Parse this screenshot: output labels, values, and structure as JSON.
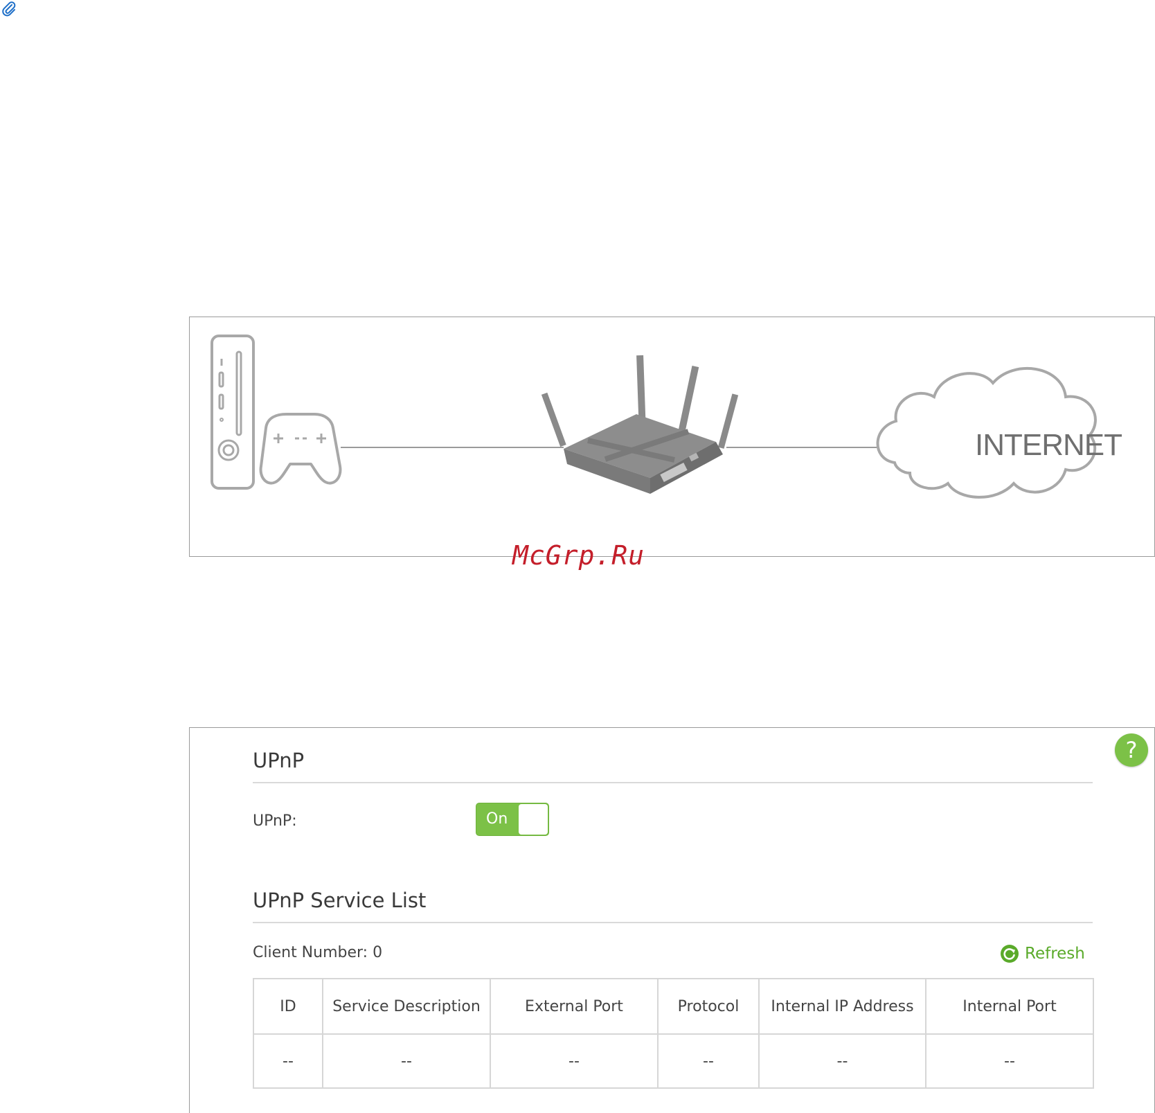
{
  "diagram": {
    "internet_label": "INTERNET"
  },
  "watermark": "McGrp.Ru",
  "upnp": {
    "section_title": "UPnP",
    "field_label": "UPnP:",
    "toggle_state": "On",
    "help_label": "?"
  },
  "service_list": {
    "section_title": "UPnP Service List",
    "client_number_label": "Client Number:",
    "client_number_value": "0",
    "refresh_label": "Refresh",
    "columns": [
      "ID",
      "Service Description",
      "External Port",
      "Protocol",
      "Internal IP Address",
      "Internal Port"
    ],
    "rows": [
      [
        "--",
        "--",
        "--",
        "--",
        "--",
        "--"
      ]
    ]
  },
  "colors": {
    "accent_green": "#7cc147",
    "watermark_red": "#c41e2a"
  }
}
